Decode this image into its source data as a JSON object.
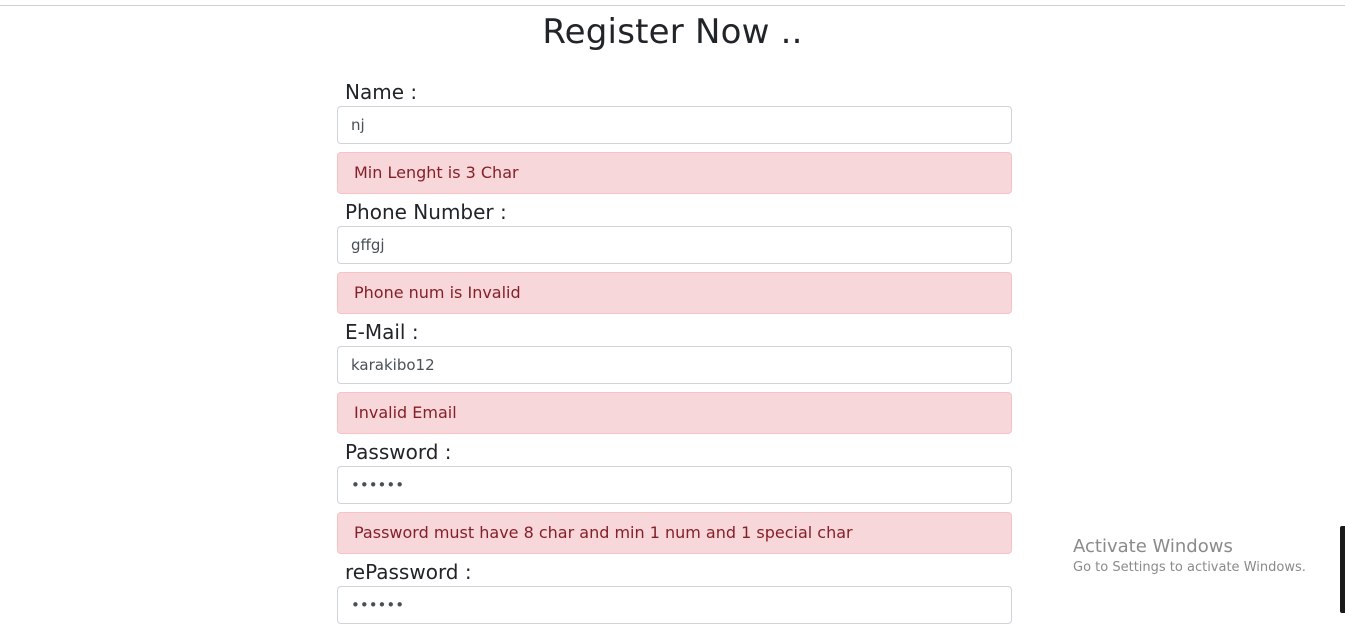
{
  "page": {
    "title": "Register Now .."
  },
  "form": {
    "fields": [
      {
        "label": "Name :",
        "value": "nj",
        "error": "Min Lenght is 3 Char"
      },
      {
        "label": "Phone Number :",
        "value": "gffgj",
        "error": "Phone num is Invalid"
      },
      {
        "label": "E-Mail :",
        "value": "karakibo12",
        "error": "Invalid Email"
      },
      {
        "label": "Password :",
        "value": "••••••",
        "error": "Password must have 8 char and min 1 num and 1 special char"
      },
      {
        "label": "rePassword :",
        "value": "••••••"
      }
    ]
  },
  "watermark": {
    "title": "Activate Windows",
    "subtitle": "Go to Settings to activate Windows."
  }
}
